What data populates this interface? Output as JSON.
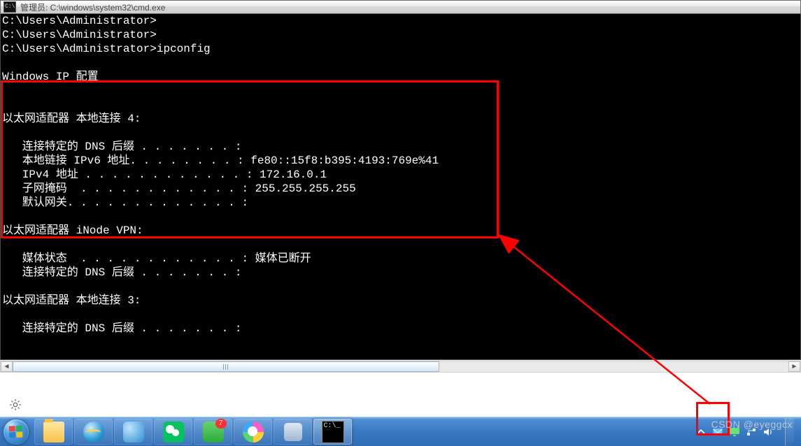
{
  "window": {
    "title": "管理员: C:\\windows\\system32\\cmd.exe"
  },
  "terminal": {
    "lines": [
      "C:\\Users\\Administrator>",
      "C:\\Users\\Administrator>",
      "C:\\Users\\Administrator>ipconfig",
      "",
      "Windows IP 配置",
      "",
      "",
      "以太网适配器 本地连接 4:",
      "",
      "   连接特定的 DNS 后缀 . . . . . . . :",
      "   本地链接 IPv6 地址. . . . . . . . : fe80::15f8:b395:4193:769e%41",
      "   IPv4 地址 . . . . . . . . . . . . : 172.16.0.1",
      "   子网掩码  . . . . . . . . . . . . : 255.255.255.255",
      "   默认网关. . . . . . . . . . . . . :",
      "",
      "以太网适配器 iNode VPN:",
      "",
      "   媒体状态  . . . . . . . . . . . . : 媒体已断开",
      "   连接特定的 DNS 后缀 . . . . . . . :",
      "",
      "以太网适配器 本地连接 3:",
      "",
      "   连接特定的 DNS 后缀 . . . . . . . :"
    ]
  },
  "taskbar": {
    "badge_security": "7"
  },
  "watermark": "CSDN @eyeggcx"
}
